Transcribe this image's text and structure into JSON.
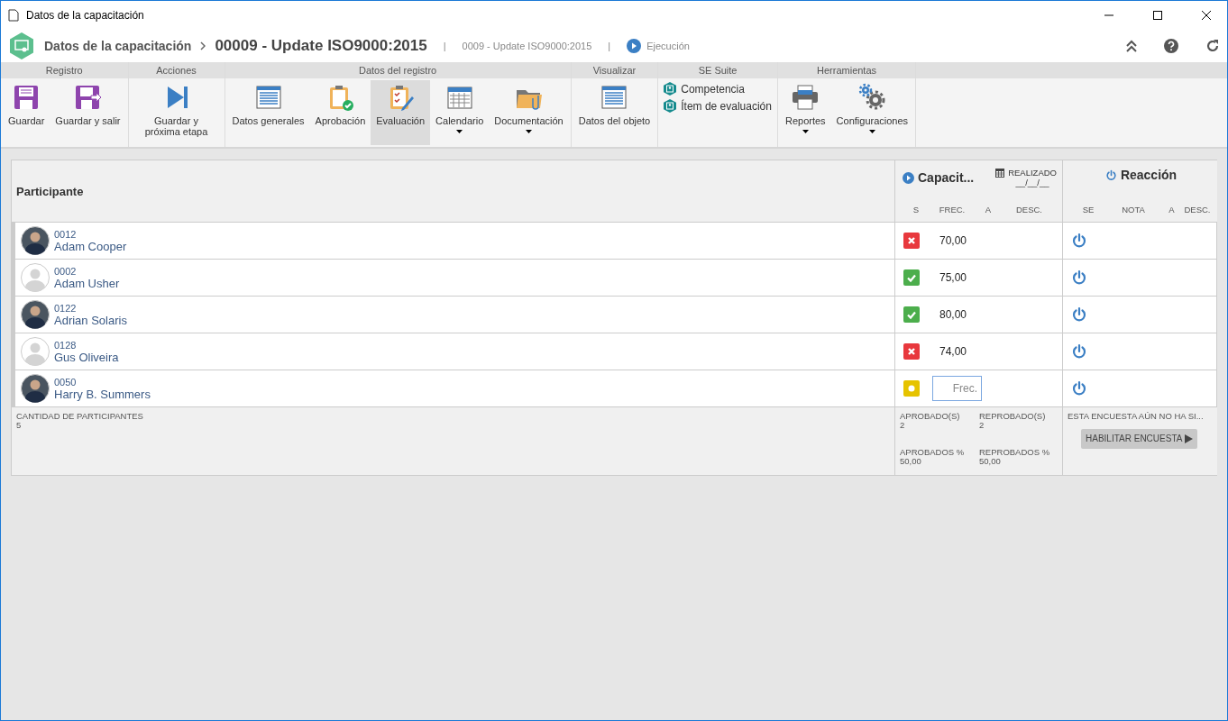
{
  "window": {
    "title": "Datos de la capacitación"
  },
  "header": {
    "breadcrumb": "Datos de la capacitación",
    "title": "00009 - Update ISO9000:2015",
    "divider": "|",
    "subtitle": "0009 - Update ISO9000:2015",
    "divider_2": "|",
    "status": "Ejecución"
  },
  "ribbon": [
    {
      "heading": "Registro",
      "items": [
        {
          "kind": "large",
          "label": "Guardar",
          "selected": false,
          "dropdown": false
        },
        {
          "kind": "large",
          "label": "Guardar y salir",
          "selected": false,
          "dropdown": false
        }
      ]
    },
    {
      "heading": "Acciones",
      "items": [
        {
          "kind": "large",
          "label": "Guardar y próxima etapa",
          "selected": false,
          "dropdown": false
        }
      ]
    },
    {
      "heading": "Datos del registro",
      "items": [
        {
          "kind": "large",
          "label": "Datos generales",
          "selected": false,
          "dropdown": false
        },
        {
          "kind": "large",
          "label": "Aprobación",
          "selected": false,
          "dropdown": false
        },
        {
          "kind": "large",
          "label": "Evaluación",
          "selected": true,
          "dropdown": false
        },
        {
          "kind": "large",
          "label": "Calendario",
          "selected": false,
          "dropdown": true
        },
        {
          "kind": "large",
          "label": "Documentación",
          "selected": false,
          "dropdown": true
        }
      ]
    },
    {
      "heading": "Visualizar",
      "items": [
        {
          "kind": "large",
          "label": "Datos del objeto",
          "selected": false,
          "dropdown": false
        }
      ]
    },
    {
      "heading": "SE Suite",
      "items": [
        {
          "kind": "small",
          "label": "Competencia"
        },
        {
          "kind": "small",
          "label": "Ítem de evaluación"
        }
      ]
    },
    {
      "heading": "Herramientas",
      "items": [
        {
          "kind": "large",
          "label": "Reportes",
          "selected": false,
          "dropdown": true
        },
        {
          "kind": "large",
          "label": "Configuraciones",
          "selected": false,
          "dropdown": true
        }
      ]
    }
  ],
  "table": {
    "participant_heading": "Participante",
    "training": {
      "title": "Capacit...",
      "done_label": "REALIZADO",
      "done_date": "__/__/__",
      "columns": [
        "S",
        "FREC.",
        "A",
        "DESC."
      ]
    },
    "reaction": {
      "title": "Reacción",
      "columns": [
        "SE",
        "NOTA",
        "A",
        "DESC."
      ]
    },
    "rows": [
      {
        "code": "0012",
        "name": "Adam Cooper",
        "photo": true,
        "kind": "failed",
        "frequency": "70,00"
      },
      {
        "code": "0002",
        "name": "Adam Usher",
        "photo": false,
        "kind": "passed",
        "frequency": "75,00"
      },
      {
        "code": "0122",
        "name": "Adrian Solaris",
        "photo": true,
        "kind": "passed",
        "frequency": "80,00"
      },
      {
        "code": "0128",
        "name": "Gus Oliveira",
        "photo": false,
        "kind": "failed",
        "frequency": "74,00"
      },
      {
        "code": "0050",
        "name": "Harry B. Summers",
        "photo": true,
        "kind": "pending",
        "frequency_placeholder": "Frec."
      }
    ],
    "footer": {
      "count_label": "CANTIDAD DE PARTICIPANTES",
      "count": "5",
      "stats": [
        {
          "label": "APROBADO(S)",
          "value": "2"
        },
        {
          "label": "REPROBADO(S)",
          "value": "2"
        },
        {
          "label": "APROBADOS %",
          "value": "50,00"
        },
        {
          "label": "REPROBADOS %",
          "value": "50,00"
        }
      ],
      "survey_notice": "ESTA ENCUESTA AÚN NO HA SI...",
      "enable_button": "HABILITAR ENCUESTA"
    }
  }
}
